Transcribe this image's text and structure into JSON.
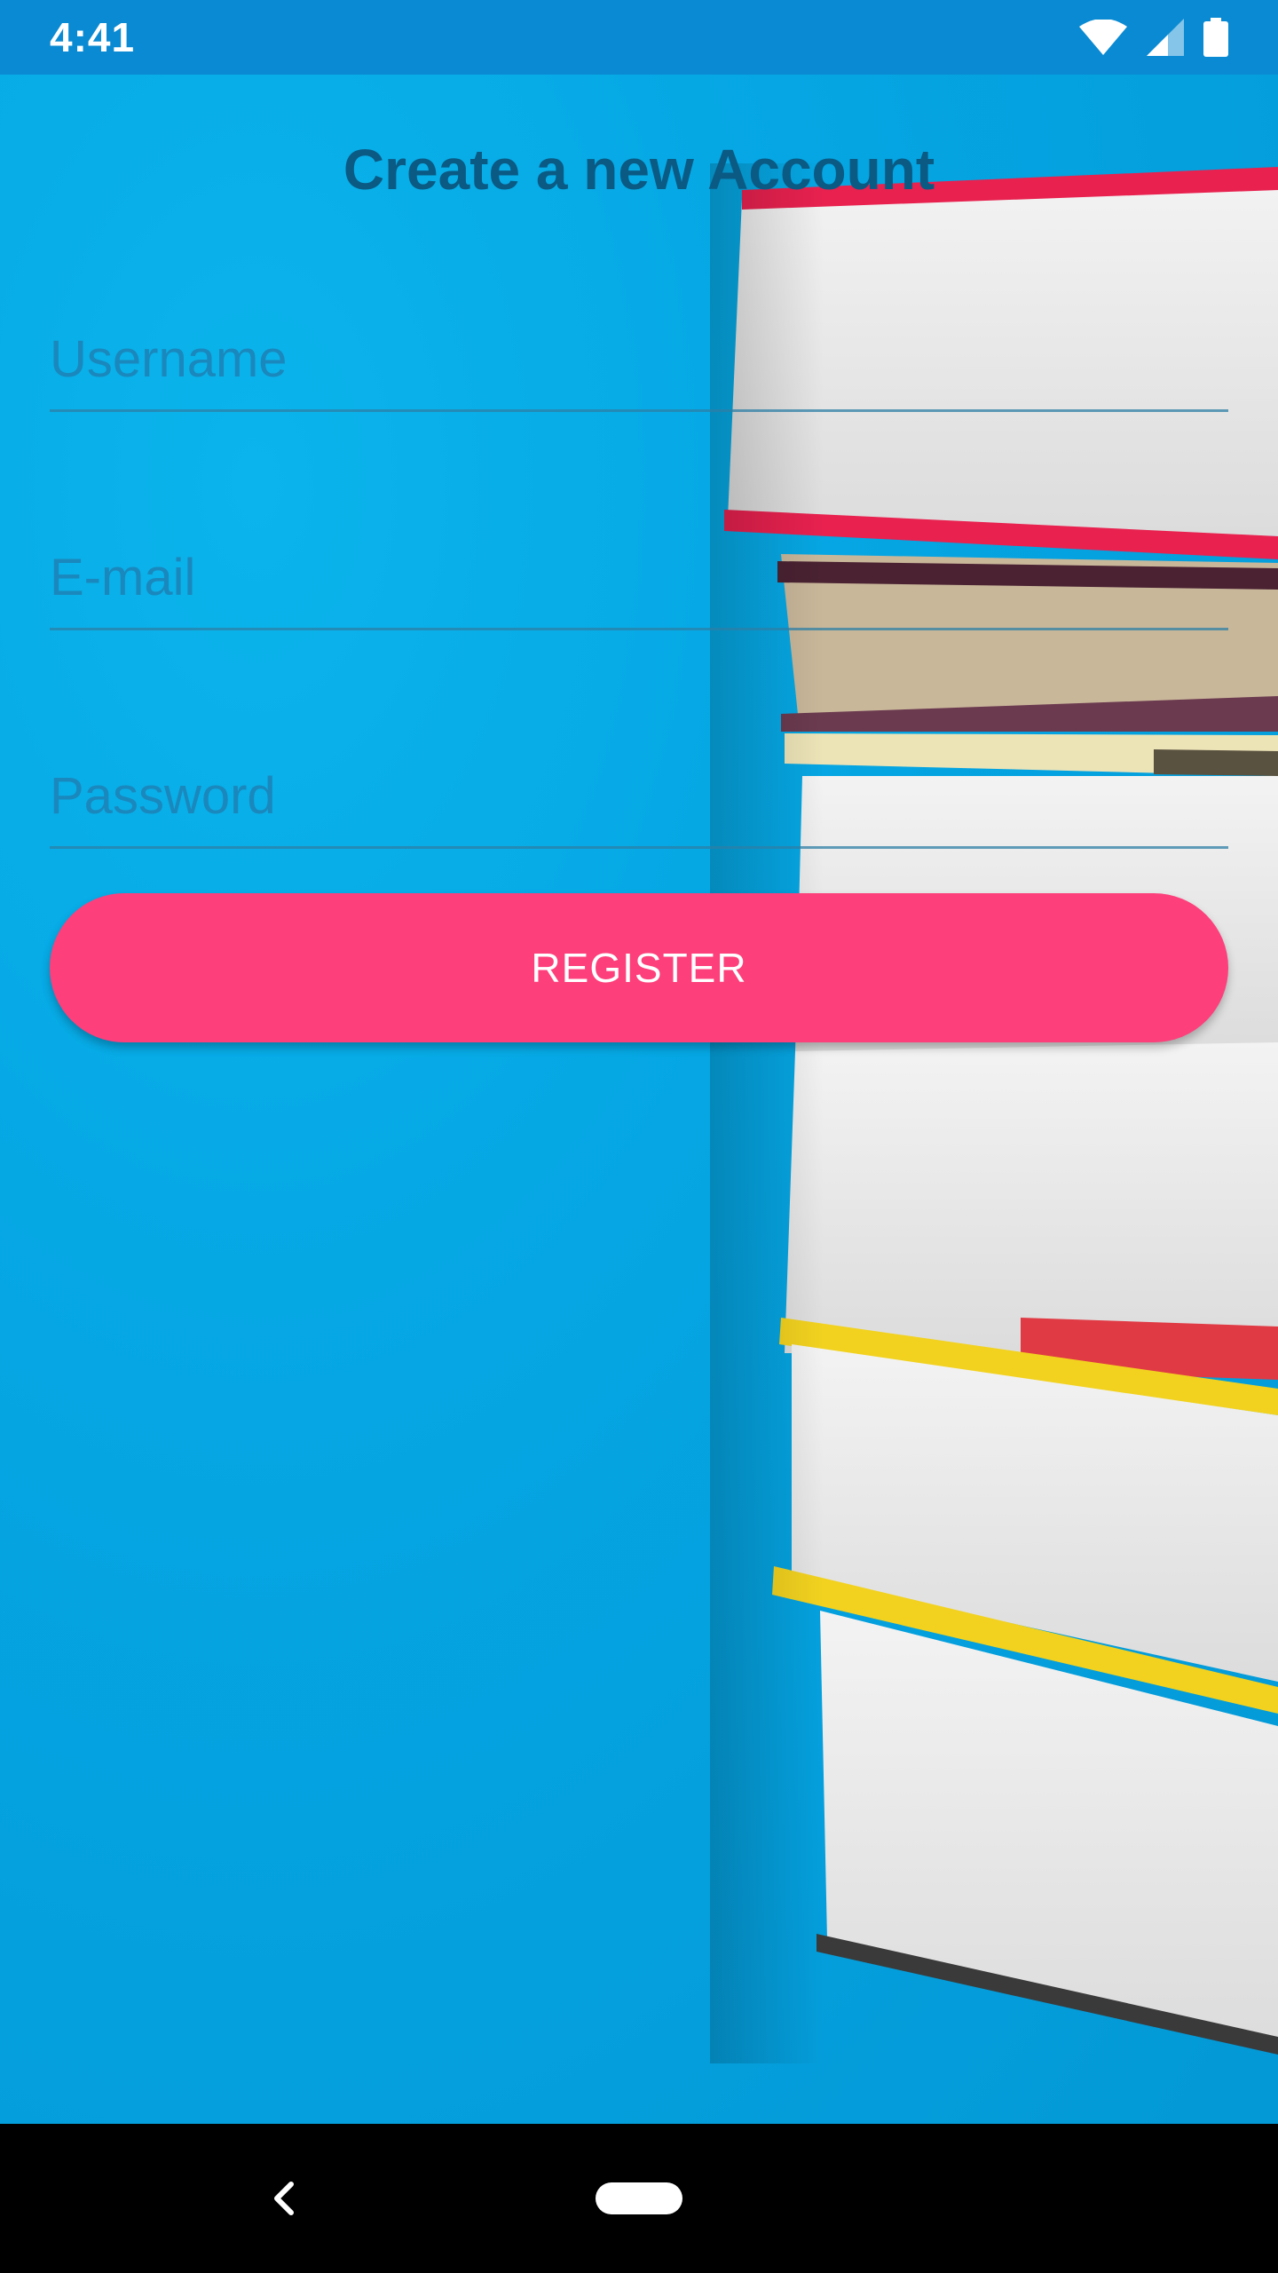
{
  "status_bar": {
    "time": "4:41",
    "icons": [
      "wifi-icon",
      "cell-signal-icon",
      "battery-icon"
    ]
  },
  "page": {
    "title": "Create a new Account"
  },
  "form": {
    "username_placeholder": "Username",
    "email_placeholder": "E-mail",
    "password_placeholder": "Password",
    "register_label": "REGISTER"
  },
  "colors": {
    "background": "#05a6e3",
    "title": "#0a5a84",
    "accent": "#fd3f7b",
    "status_bar": "#0a8ad2"
  },
  "nav_bar": {
    "icons": [
      "back-icon",
      "home-pill-icon"
    ]
  }
}
